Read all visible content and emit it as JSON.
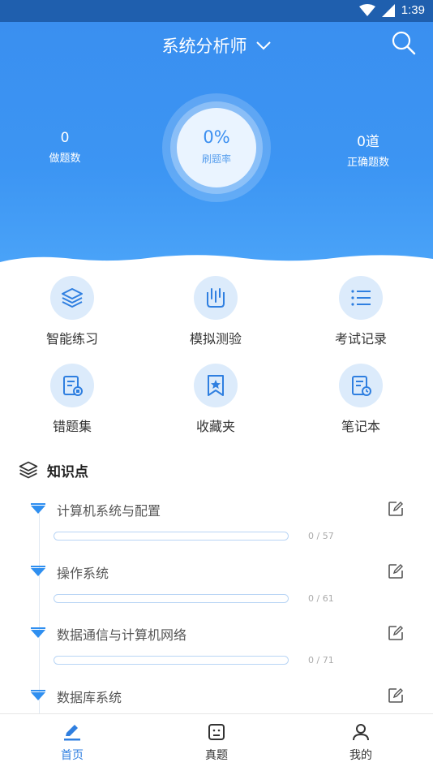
{
  "status": {
    "time": "1:39"
  },
  "header": {
    "title": "系统分析师"
  },
  "stats": {
    "done_value": "0",
    "done_label": "做题数",
    "rate_value": "0%",
    "rate_label": "刷题率",
    "correct_value": "0道",
    "correct_label": "正确题数"
  },
  "grid": [
    {
      "label": "智能练习",
      "icon": "layers-icon"
    },
    {
      "label": "模拟测验",
      "icon": "flask-icon"
    },
    {
      "label": "考试记录",
      "icon": "list-icon"
    },
    {
      "label": "错题集",
      "icon": "wrong-doc-icon"
    },
    {
      "label": "收藏夹",
      "icon": "star-bookmark-icon"
    },
    {
      "label": "笔记本",
      "icon": "note-clock-icon"
    }
  ],
  "knowledge": {
    "title": "知识点",
    "items": [
      {
        "name": "计算机系统与配置",
        "count": "0 / 57",
        "progress": 0
      },
      {
        "name": "操作系统",
        "count": "0 / 61",
        "progress": 0
      },
      {
        "name": "数据通信与计算机网络",
        "count": "0 / 71",
        "progress": 0
      },
      {
        "name": "数据库系统",
        "count": "",
        "progress": 0
      }
    ]
  },
  "tabs": [
    {
      "label": "首页",
      "icon": "pencil-icon",
      "active": true
    },
    {
      "label": "真题",
      "icon": "exam-icon",
      "active": false
    },
    {
      "label": "我的",
      "icon": "user-icon",
      "active": false
    }
  ],
  "colors": {
    "primary": "#3b8ff0",
    "active_tab": "#2f7fe0",
    "inactive_tab": "#333333"
  }
}
